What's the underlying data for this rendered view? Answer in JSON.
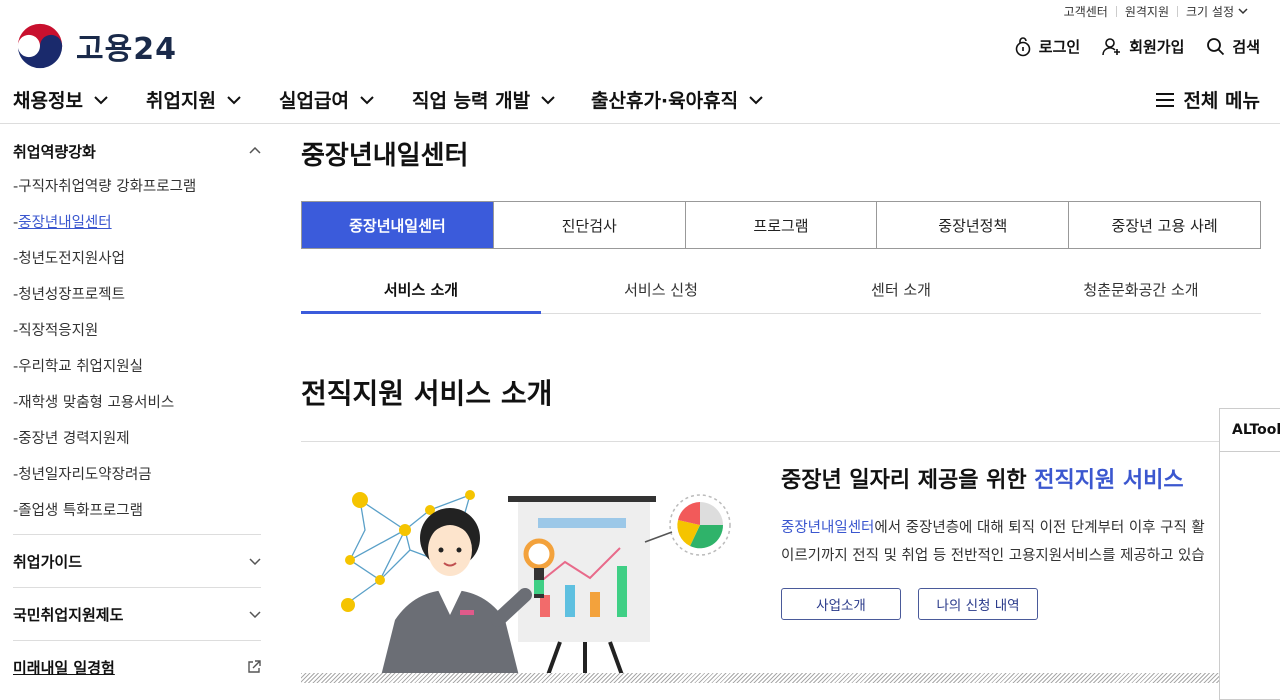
{
  "util": {
    "items": [
      "고객센터",
      "원격지원",
      "크기 설정"
    ]
  },
  "logo": {
    "text": "고용24"
  },
  "user_menu": {
    "login": "로그인",
    "signup": "회원가입",
    "search": "검색"
  },
  "gnb": {
    "items": [
      "채용정보",
      "취업지원",
      "실업급여",
      "직업 능력 개발",
      "출산휴가·육아휴직"
    ],
    "all_menu": "전체 메뉴"
  },
  "sidebar": {
    "group_title": "취업역량강화",
    "items": [
      "구직자취업역량 강화프로그램",
      "중장년내일센터",
      "청년도전지원사업",
      "청년성장프로젝트",
      "직장적응지원",
      "우리학교 취업지원실",
      "재학생 맞춤형 고용서비스",
      "중장년 경력지원제",
      "청년일자리도약장려금",
      "졸업생 특화프로그램"
    ],
    "active_index": 1,
    "sections": [
      "취업가이드",
      "국민취업지원제도",
      "미래내일 일경험"
    ]
  },
  "main": {
    "page_title": "중장년내일센터",
    "tabs": [
      "중장년내일센터",
      "진단검사",
      "프로그램",
      "중장년정책",
      "중장년 고용 사례"
    ],
    "subtabs": [
      "서비스 소개",
      "서비스 신청",
      "센터 소개",
      "청춘문화공간 소개"
    ],
    "section_title": "전직지원 서비스 소개",
    "intro": {
      "heading_prefix": "중장년 일자리 제공을 위한 ",
      "heading_highlight": "전직지원 서비스",
      "body_link": "중장년내일센터",
      "body_line1_rest": "에서 중장년층에 대해 퇴직 이전 단계부터 이후 구직 활",
      "body_line2": "이르기까지 전직 및 취업 등 전반적인 고용지원서비스를 제공하고 있습",
      "buttons": [
        "사업소개",
        "나의 신청 내역"
      ]
    }
  },
  "altools": {
    "label": "ALTools"
  },
  "colors": {
    "accent": "#3b5bdb",
    "link": "#3b57cf"
  }
}
